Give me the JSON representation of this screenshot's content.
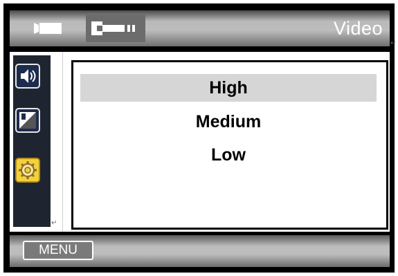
{
  "header": {
    "title": "Video",
    "icons": [
      "camera-icon",
      "wrench-icon"
    ]
  },
  "sidebar": {
    "items": [
      {
        "icon": "speaker-icon",
        "selected": false
      },
      {
        "icon": "exposure-icon",
        "selected": false
      },
      {
        "icon": "gear-icon",
        "selected": true
      }
    ]
  },
  "menu": {
    "options": [
      "High",
      "Medium",
      "Low"
    ],
    "selected_index": 0
  },
  "footer": {
    "menu_label": "MENU"
  },
  "colors": {
    "accent_yellow": "#f2d13a",
    "selection_gray": "#d6d6d6",
    "sidebar_bg": "#1f2530"
  }
}
